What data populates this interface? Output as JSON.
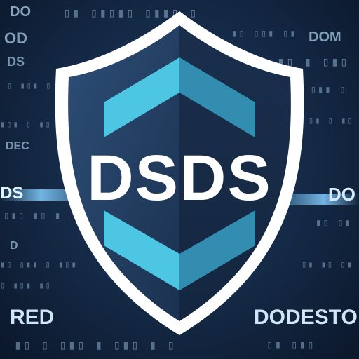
{
  "logo": {
    "text": "DSDS"
  },
  "background_words": {
    "top_left": "DO",
    "left_upper_1": "OD",
    "left_upper_2": "DS",
    "left_mid": "DEC",
    "left_band": "DS",
    "left_lower": "D",
    "bottom_left": "RED",
    "right_upper": "DOM",
    "right_band": "DO",
    "bottom_right": "DODESTO"
  },
  "colors": {
    "background": "#162c4a",
    "shield_outline": "#ffffff",
    "shield_dark": "#1d3350",
    "chevron": "#4cc6e3",
    "logo_text": "#ffffff"
  }
}
